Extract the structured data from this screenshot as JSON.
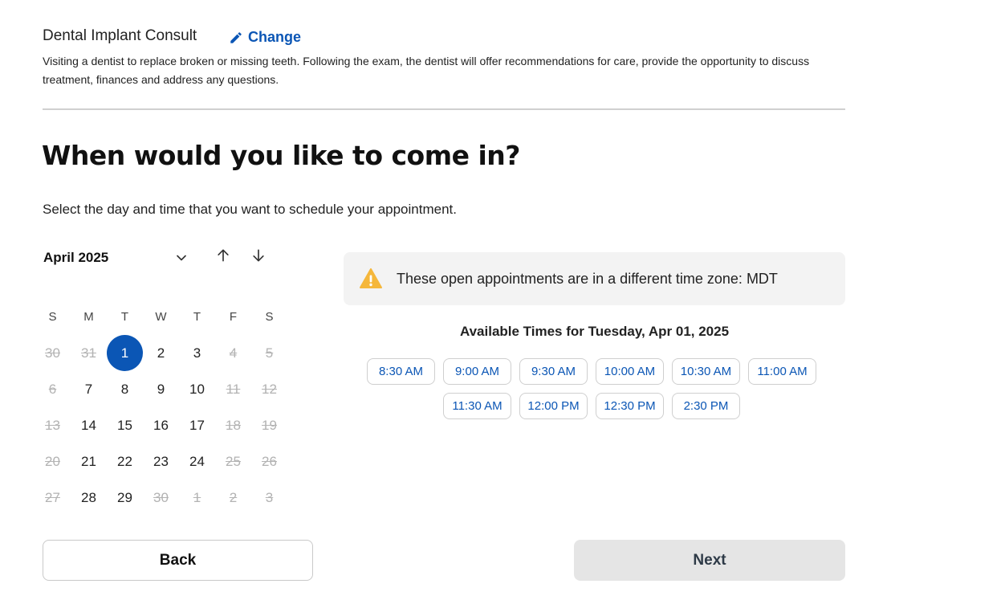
{
  "service": {
    "title": "Dental Implant Consult",
    "change_label": "Change",
    "description": "Visiting a dentist to replace broken or missing teeth. Following the exam, the dentist will offer recommendations for care, provide the opportunity to discuss treatment, finances and address any questions."
  },
  "heading": "When would you like to come in?",
  "subheading": "Select the day and time that you want to schedule your appointment.",
  "calendar": {
    "month_label": "April 2025",
    "weekdays": [
      "S",
      "M",
      "T",
      "W",
      "T",
      "F",
      "S"
    ],
    "weeks": [
      [
        {
          "d": "30",
          "s": "disabled"
        },
        {
          "d": "31",
          "s": "disabled"
        },
        {
          "d": "1",
          "s": "selected"
        },
        {
          "d": "2",
          "s": "available"
        },
        {
          "d": "3",
          "s": "available"
        },
        {
          "d": "4",
          "s": "disabled"
        },
        {
          "d": "5",
          "s": "disabled"
        }
      ],
      [
        {
          "d": "6",
          "s": "disabled"
        },
        {
          "d": "7",
          "s": "available"
        },
        {
          "d": "8",
          "s": "available"
        },
        {
          "d": "9",
          "s": "available"
        },
        {
          "d": "10",
          "s": "available"
        },
        {
          "d": "11",
          "s": "disabled"
        },
        {
          "d": "12",
          "s": "disabled"
        }
      ],
      [
        {
          "d": "13",
          "s": "disabled"
        },
        {
          "d": "14",
          "s": "available"
        },
        {
          "d": "15",
          "s": "available"
        },
        {
          "d": "16",
          "s": "available"
        },
        {
          "d": "17",
          "s": "available"
        },
        {
          "d": "18",
          "s": "disabled"
        },
        {
          "d": "19",
          "s": "disabled"
        }
      ],
      [
        {
          "d": "20",
          "s": "disabled"
        },
        {
          "d": "21",
          "s": "available"
        },
        {
          "d": "22",
          "s": "available"
        },
        {
          "d": "23",
          "s": "available"
        },
        {
          "d": "24",
          "s": "available"
        },
        {
          "d": "25",
          "s": "disabled"
        },
        {
          "d": "26",
          "s": "disabled"
        }
      ],
      [
        {
          "d": "27",
          "s": "disabled"
        },
        {
          "d": "28",
          "s": "available"
        },
        {
          "d": "29",
          "s": "available"
        },
        {
          "d": "30",
          "s": "disabled"
        },
        {
          "d": "1",
          "s": "disabled"
        },
        {
          "d": "2",
          "s": "disabled"
        },
        {
          "d": "3",
          "s": "disabled"
        }
      ]
    ]
  },
  "timezone_notice": "These open appointments are in a different time zone: MDT",
  "available_title": "Available Times for Tuesday, Apr 01, 2025",
  "time_slots": [
    "8:30 AM",
    "9:00 AM",
    "9:30 AM",
    "10:00 AM",
    "10:30 AM",
    "11:00 AM",
    "11:30 AM",
    "12:00 PM",
    "12:30 PM",
    "2:30 PM"
  ],
  "buttons": {
    "back": "Back",
    "next": "Next"
  },
  "colors": {
    "accent": "#0b56b5",
    "warning": "#f5b73b",
    "disabled_text": "#b3b3b3"
  },
  "icons": {
    "change": "pencil-icon",
    "month_dropdown": "chevron-down-icon",
    "prev_month": "arrow-up-icon",
    "next_month": "arrow-down-icon",
    "timezone": "warning-icon"
  }
}
